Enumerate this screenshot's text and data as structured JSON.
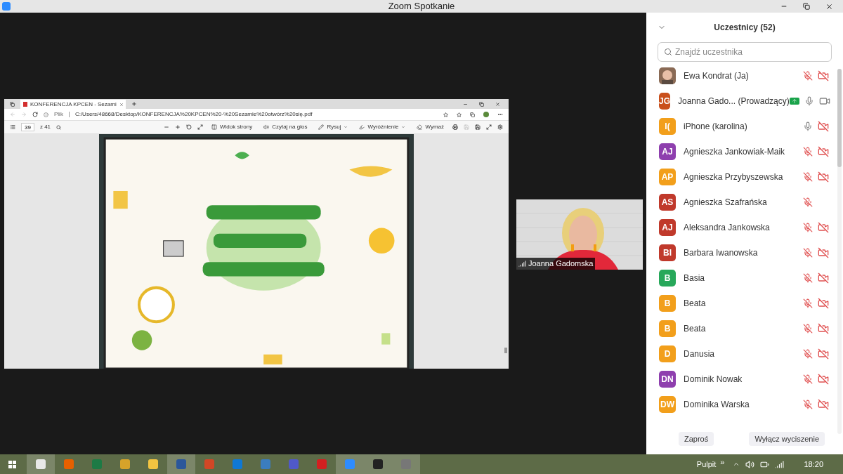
{
  "window": {
    "title": "Zoom Spotkanie"
  },
  "browser": {
    "tab": "KONFERENCJA KPCEN - Sezami",
    "file_label": "Plik",
    "url": "C:/Users/48668/Desktop/KONFERENCJA%20KPCEN%20-%20Sezamie%20otwórz%20się.pdf",
    "page": "39",
    "page_total": "z 41",
    "tools": [
      {
        "kind": "view",
        "label": "Widok strony"
      },
      {
        "kind": "read",
        "label": "Czytaj na głos"
      },
      {
        "kind": "draw",
        "label": "Rysuj"
      },
      {
        "kind": "highlight",
        "label": "Wyróżnienie"
      },
      {
        "kind": "erase",
        "label": "Wymaż"
      }
    ]
  },
  "video": {
    "name": "Joanna Gadomska"
  },
  "participants_panel": {
    "title": "Uczestnicy (52)",
    "search": {
      "placeholder": "Znajdź uczestnika"
    },
    "participants": [
      {
        "name": "Ewa Kondrat (Ja)",
        "muted": true,
        "camera_on": false,
        "sharing": false
      },
      {
        "initials": "JG",
        "color": "#c9501c",
        "name": "Joanna Gado... (Prowadzący)",
        "muted": false,
        "camera_on": true,
        "sharing": true
      },
      {
        "initials": "I(",
        "color": "#f29f1b",
        "name": "iPhone (karolina)",
        "muted": false,
        "camera_on": false,
        "sharing": false
      },
      {
        "initials": "AJ",
        "color": "#8e3fae",
        "name": "Agnieszka Jankowiak-Maik",
        "muted": true,
        "camera_on": false,
        "sharing": false
      },
      {
        "initials": "AP",
        "color": "#f29f1b",
        "name": "Agnieszka Przybyszewska",
        "muted": true,
        "camera_on": false,
        "sharing": false
      },
      {
        "initials": "AS",
        "color": "#c0392b",
        "name": "Agnieszka Szafrańska",
        "muted": true,
        "sharing": false
      },
      {
        "initials": "AJ",
        "color": "#c0392b",
        "name": "Aleksandra Jankowska",
        "muted": true,
        "camera_on": false,
        "sharing": false
      },
      {
        "initials": "BI",
        "color": "#c0392b",
        "name": "Barbara Iwanowska",
        "muted": true,
        "camera_on": false,
        "sharing": false
      },
      {
        "initials": "B",
        "color": "#27a85a",
        "name": "Basia",
        "muted": true,
        "camera_on": false,
        "sharing": false
      },
      {
        "initials": "B",
        "color": "#f29f1b",
        "name": "Beata",
        "muted": true,
        "camera_on": false,
        "sharing": false
      },
      {
        "initials": "B",
        "color": "#f29f1b",
        "name": "Beata",
        "muted": true,
        "camera_on": false,
        "sharing": false
      },
      {
        "initials": "D",
        "color": "#f29f1b",
        "name": "Danusia",
        "muted": true,
        "camera_on": false,
        "sharing": false
      },
      {
        "initials": "DN",
        "color": "#8e3fae",
        "name": "Dominik Nowak",
        "muted": true,
        "camera_on": false,
        "sharing": false
      },
      {
        "initials": "DW",
        "color": "#f29f1b",
        "name": "Dominika Warska",
        "muted": true,
        "camera_on": false,
        "sharing": false
      }
    ],
    "buttons": [
      "Zaproś",
      "Wyłącz wyciszenie"
    ]
  },
  "taskbar": {
    "desktop_label": "Pulpit",
    "overflow": "»",
    "clock": "18:20"
  }
}
